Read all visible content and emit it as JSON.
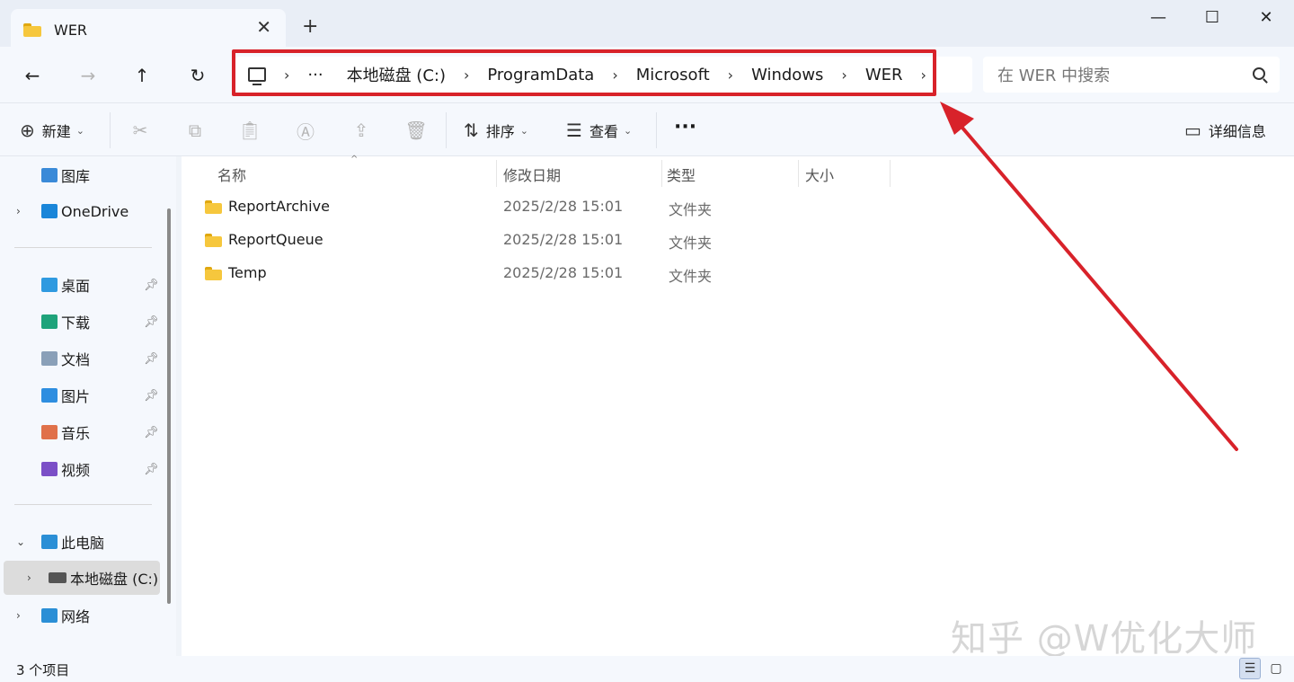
{
  "window": {
    "tab_title": "WER",
    "tab_close": "✕",
    "new_tab": "+",
    "minimize": "—",
    "maximize": "☐",
    "close": "✕"
  },
  "nav": {
    "back": "←",
    "forward": "→",
    "up": "↑",
    "refresh": "↻"
  },
  "breadcrumb": {
    "ellipsis": "···",
    "items": [
      "本地磁盘 (C:)",
      "ProgramData",
      "Microsoft",
      "Windows",
      "WER"
    ],
    "separator": "›"
  },
  "search": {
    "placeholder": "在 WER 中搜索"
  },
  "toolbar": {
    "new_label": "新建",
    "sort_label": "排序",
    "view_label": "查看",
    "more": "···",
    "details_label": "详细信息"
  },
  "sidebar": {
    "items": [
      {
        "label": "图库"
      },
      {
        "label": "OneDrive"
      },
      {
        "label": "桌面"
      },
      {
        "label": "下载"
      },
      {
        "label": "文档"
      },
      {
        "label": "图片"
      },
      {
        "label": "音乐"
      },
      {
        "label": "视频"
      },
      {
        "label": "此电脑"
      },
      {
        "label": "本地磁盘 (C:)"
      },
      {
        "label": "网络"
      }
    ]
  },
  "columns": {
    "name": "名称",
    "modified": "修改日期",
    "type": "类型",
    "size": "大小"
  },
  "files": [
    {
      "name": "ReportArchive",
      "modified": "2025/2/28 15:01",
      "type": "文件夹"
    },
    {
      "name": "ReportQueue",
      "modified": "2025/2/28 15:01",
      "type": "文件夹"
    },
    {
      "name": "Temp",
      "modified": "2025/2/28 15:01",
      "type": "文件夹"
    }
  ],
  "status": {
    "item_count": "3 个项目"
  },
  "watermark": "知乎 @W优化大师",
  "colors": {
    "highlight": "#d8222a",
    "folder": "#f6c73d"
  }
}
